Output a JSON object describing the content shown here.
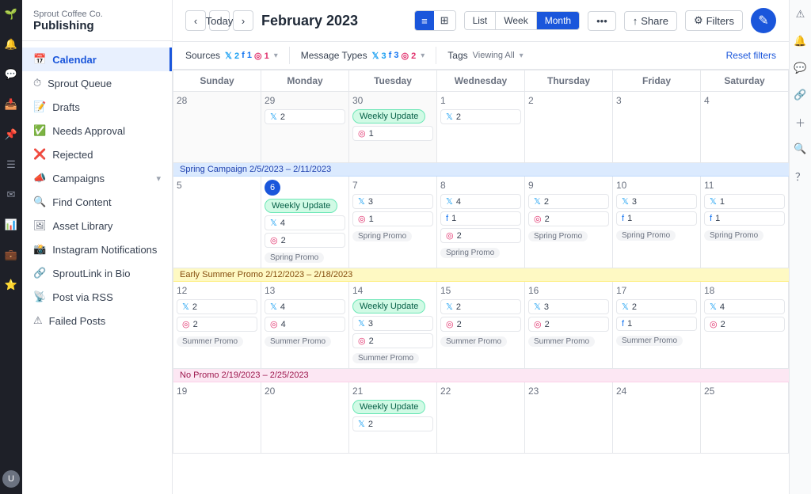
{
  "app": {
    "company": "Sprout Coffee Co.",
    "title": "Publishing"
  },
  "sidebar": {
    "items": [
      {
        "id": "calendar",
        "label": "Calendar",
        "active": true
      },
      {
        "id": "sprout-queue",
        "label": "Sprout Queue",
        "active": false
      },
      {
        "id": "drafts",
        "label": "Drafts",
        "active": false
      },
      {
        "id": "needs-approval",
        "label": "Needs Approval",
        "active": false
      },
      {
        "id": "rejected",
        "label": "Rejected",
        "active": false
      },
      {
        "id": "campaigns",
        "label": "Campaigns",
        "active": false,
        "hasChevron": true
      },
      {
        "id": "find-content",
        "label": "Find Content",
        "active": false
      },
      {
        "id": "asset-library",
        "label": "Asset Library",
        "active": false
      },
      {
        "id": "instagram-notifications",
        "label": "Instagram Notifications",
        "active": false
      },
      {
        "id": "sproutlink-in-bio",
        "label": "SproutLink in Bio",
        "active": false
      },
      {
        "id": "post-via-rss",
        "label": "Post via RSS",
        "active": false
      },
      {
        "id": "failed-posts",
        "label": "Failed Posts",
        "active": false
      }
    ]
  },
  "topbar": {
    "today_label": "Today",
    "page_title": "February 2023",
    "view_modes": [
      "List",
      "Week",
      "Month"
    ],
    "active_view": "Month",
    "share_label": "Share",
    "filters_label": "Filters"
  },
  "filter_bar": {
    "sources_label": "Sources",
    "sources_twitter": "2",
    "sources_facebook": "1",
    "sources_instagram": "1",
    "message_types_label": "Message Types",
    "message_twitter": "3",
    "message_facebook": "3",
    "message_instagram": "2",
    "tags_label": "Tags",
    "tags_value": "Viewing All",
    "reset_label": "Reset filters"
  },
  "calendar": {
    "day_headers": [
      "Sunday",
      "Monday",
      "Tuesday",
      "Wednesday",
      "Thursday",
      "Friday",
      "Saturday"
    ],
    "week1": {
      "days": [
        {
          "num": "28",
          "other": true,
          "events": []
        },
        {
          "num": "29",
          "other": true,
          "events": [
            {
              "type": "tw",
              "count": "2"
            }
          ]
        },
        {
          "num": "30",
          "other": true,
          "events": [
            {
              "type": "weekly_update",
              "label": "Weekly Update"
            },
            {
              "type": "ig",
              "count": "1"
            }
          ]
        },
        {
          "num": "1",
          "events": [
            {
              "type": "tw",
              "count": "2"
            }
          ]
        },
        {
          "num": "2",
          "events": []
        },
        {
          "num": "3",
          "events": []
        },
        {
          "num": "4",
          "events": []
        }
      ]
    },
    "week2": {
      "campaign": {
        "label": "Spring Campaign 2/5/2023 – 2/11/2023",
        "type": "spring"
      },
      "days": [
        {
          "num": "5",
          "events": []
        },
        {
          "num": "6",
          "today": true,
          "events": [
            {
              "type": "weekly_update",
              "label": "Weekly Update"
            },
            {
              "type": "tw",
              "count": "4"
            },
            {
              "type": "ig",
              "count": "2"
            },
            {
              "type": "promo",
              "label": "Spring Promo"
            }
          ]
        },
        {
          "num": "7",
          "events": [
            {
              "type": "tw",
              "count": "3"
            },
            {
              "type": "ig",
              "count": "1"
            },
            {
              "type": "promo",
              "label": "Spring Promo"
            }
          ]
        },
        {
          "num": "8",
          "events": [
            {
              "type": "tw",
              "count": "4"
            },
            {
              "type": "fb",
              "count": "1"
            },
            {
              "type": "ig",
              "count": "2"
            },
            {
              "type": "promo",
              "label": "Spring Promo"
            }
          ]
        },
        {
          "num": "9",
          "events": [
            {
              "type": "tw",
              "count": "2"
            },
            {
              "type": "ig",
              "count": "2"
            },
            {
              "type": "promo",
              "label": "Spring Promo"
            }
          ]
        },
        {
          "num": "10",
          "events": [
            {
              "type": "tw",
              "count": "3"
            },
            {
              "type": "fb",
              "count": "1"
            },
            {
              "type": "promo",
              "label": "Spring Promo"
            }
          ]
        },
        {
          "num": "11",
          "events": [
            {
              "type": "tw",
              "count": "1"
            },
            {
              "type": "fb",
              "count": "1"
            },
            {
              "type": "promo",
              "label": "Spring Promo"
            }
          ]
        }
      ]
    },
    "week3": {
      "campaign": {
        "label": "Early Summer Promo 2/12/2023 – 2/18/2023",
        "type": "summer"
      },
      "days": [
        {
          "num": "12",
          "events": [
            {
              "type": "tw",
              "count": "2"
            },
            {
              "type": "ig",
              "count": "2"
            },
            {
              "type": "promo",
              "label": "Summer Promo"
            }
          ]
        },
        {
          "num": "13",
          "events": [
            {
              "type": "tw",
              "count": "4"
            },
            {
              "type": "ig",
              "count": "4"
            },
            {
              "type": "promo",
              "label": "Summer Promo"
            }
          ]
        },
        {
          "num": "14",
          "events": [
            {
              "type": "weekly_update",
              "label": "Weekly Update"
            },
            {
              "type": "tw",
              "count": "3"
            },
            {
              "type": "ig",
              "count": "2"
            },
            {
              "type": "promo",
              "label": "Summer Promo"
            }
          ]
        },
        {
          "num": "15",
          "events": [
            {
              "type": "tw",
              "count": "2"
            },
            {
              "type": "ig",
              "count": "2"
            },
            {
              "type": "promo",
              "label": "Summer Promo"
            }
          ]
        },
        {
          "num": "16",
          "events": [
            {
              "type": "tw",
              "count": "3"
            },
            {
              "type": "ig",
              "count": "2"
            },
            {
              "type": "promo",
              "label": "Summer Promo"
            }
          ]
        },
        {
          "num": "17",
          "events": [
            {
              "type": "tw",
              "count": "2"
            },
            {
              "type": "fb",
              "count": "1"
            },
            {
              "type": "promo",
              "label": "Summer Promo"
            }
          ]
        },
        {
          "num": "18",
          "events": [
            {
              "type": "tw",
              "count": "4"
            },
            {
              "type": "ig",
              "count": "2"
            }
          ]
        }
      ]
    },
    "week4": {
      "campaign": {
        "label": "No Promo 2/19/2023 – 2/25/2023",
        "type": "nopromo"
      },
      "days": [
        {
          "num": "19",
          "events": []
        },
        {
          "num": "20",
          "events": []
        },
        {
          "num": "21",
          "events": [
            {
              "type": "weekly_update",
              "label": "Weekly Update"
            },
            {
              "type": "tw",
              "count": "2"
            }
          ]
        },
        {
          "num": "22",
          "events": []
        },
        {
          "num": "23",
          "events": []
        },
        {
          "num": "24",
          "events": []
        },
        {
          "num": "25",
          "events": []
        }
      ]
    }
  }
}
